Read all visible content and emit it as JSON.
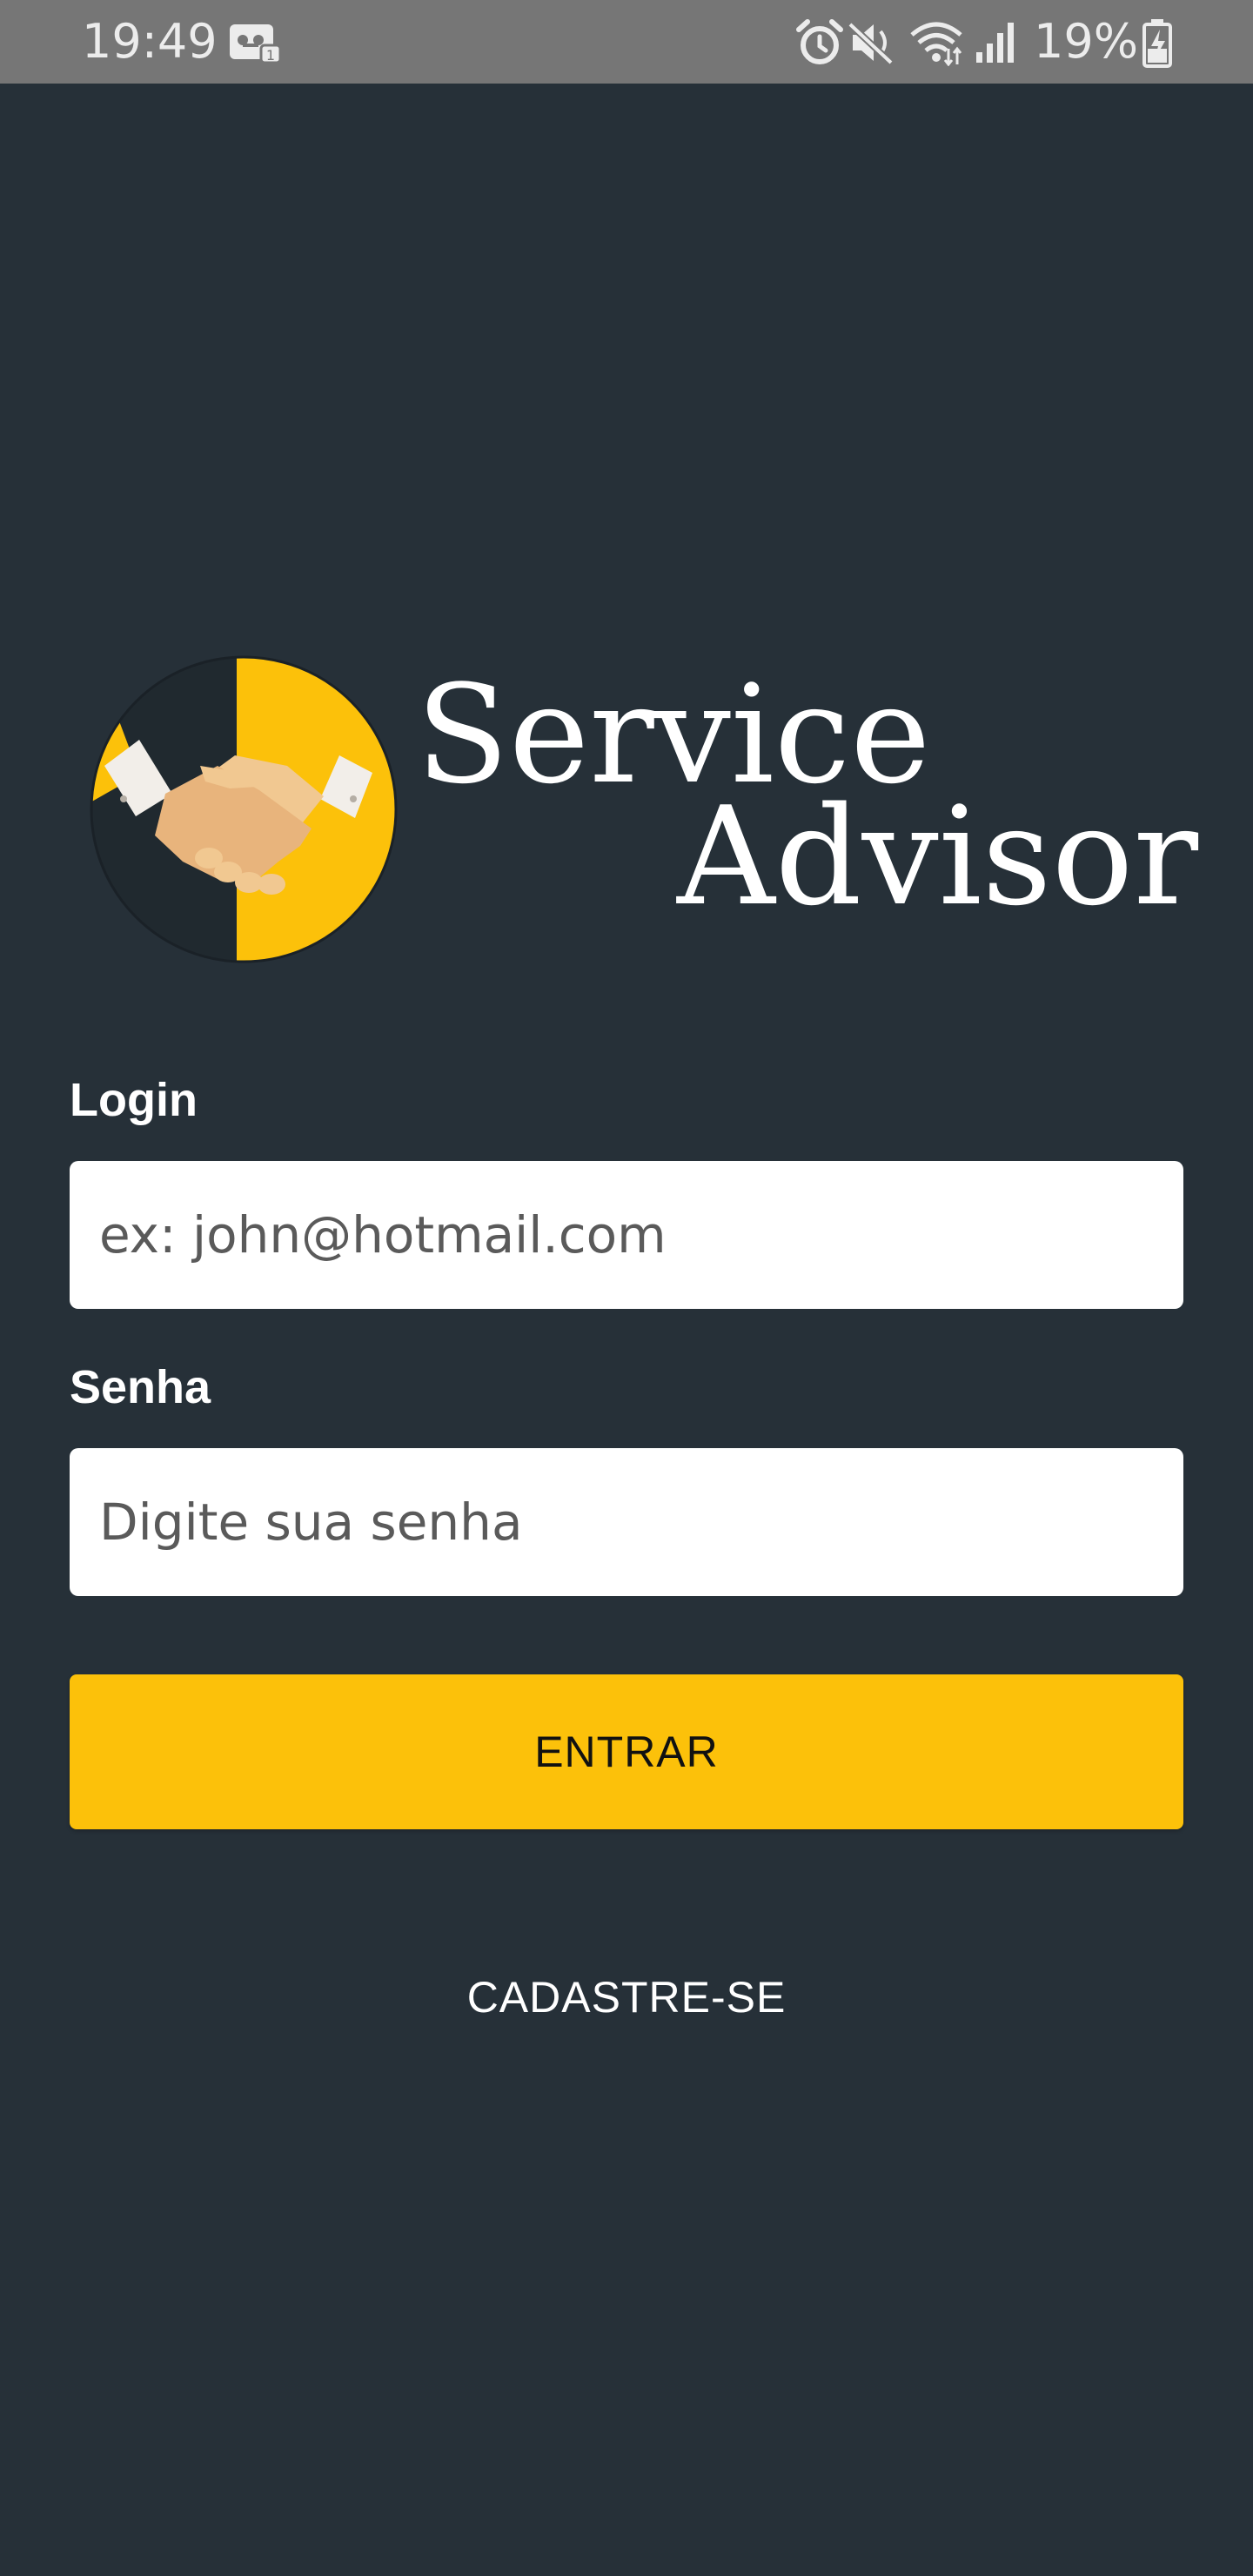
{
  "status_bar": {
    "time": "19:49",
    "battery_percent": "19%",
    "icons": [
      "voicemail-icon",
      "alarm-icon",
      "mute-icon",
      "wifi-icon",
      "signal-icon",
      "battery-charging-icon"
    ]
  },
  "brand": {
    "line1": "Service",
    "line2": "Advisor",
    "logo_icon": "handshake-icon",
    "accent_color": "#fcc10a",
    "background_color": "#263038"
  },
  "form": {
    "login_label": "Login",
    "login_placeholder": "ex: john@hotmail.com",
    "login_value": "",
    "password_label": "Senha",
    "password_placeholder": "Digite sua senha",
    "password_value": "",
    "submit_label": "ENTRAR",
    "register_label": "CADASTRE-SE"
  }
}
